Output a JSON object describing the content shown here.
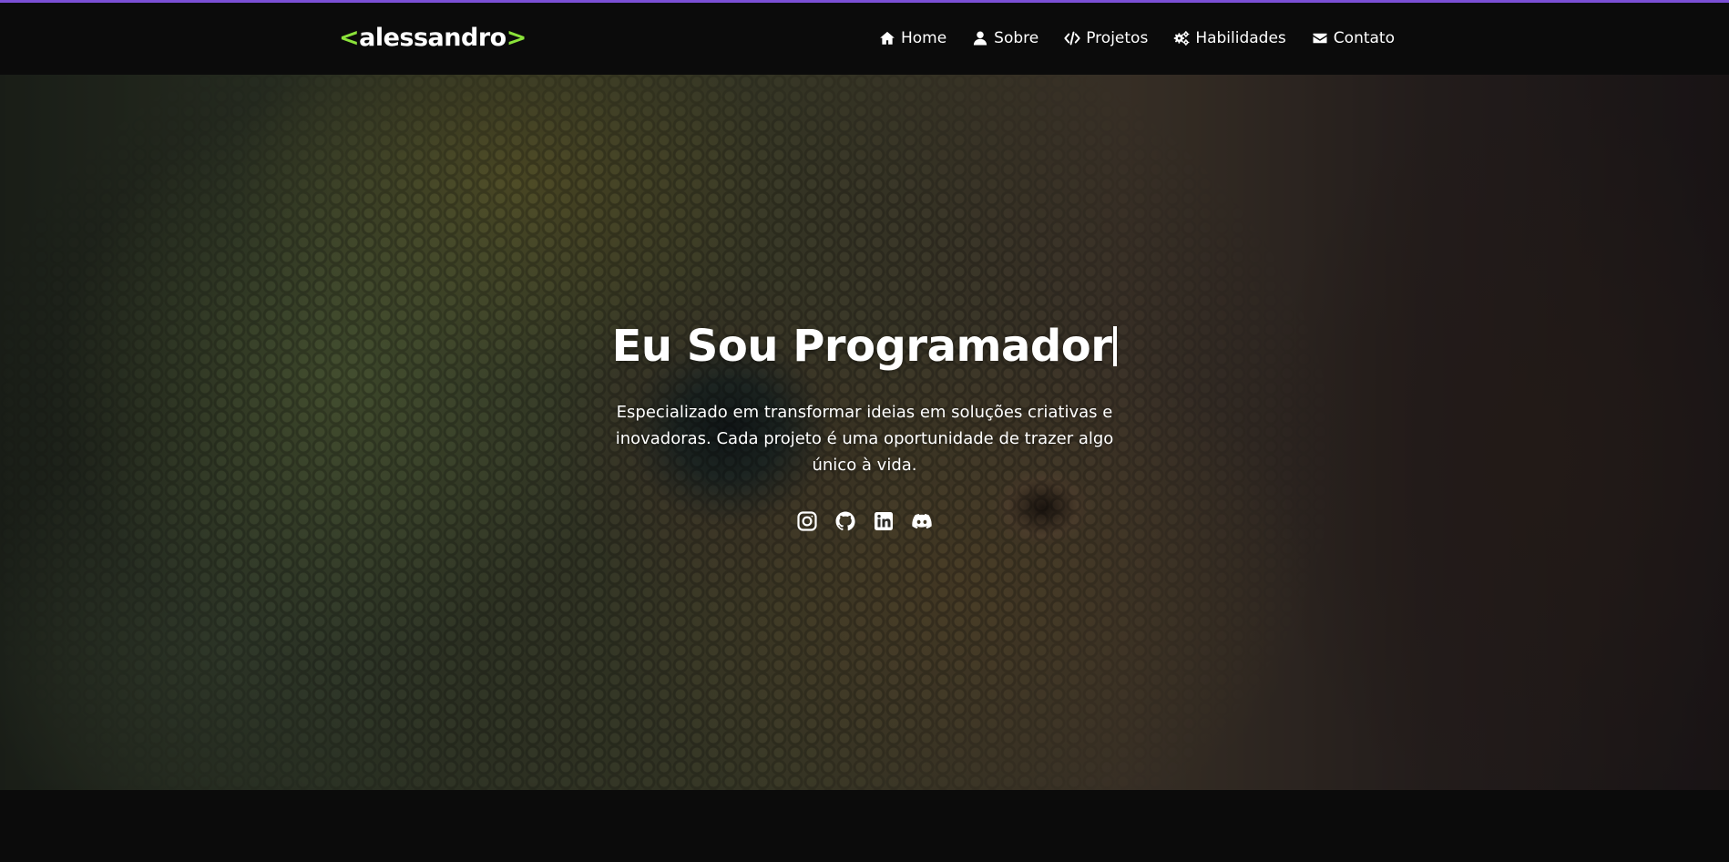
{
  "colors": {
    "accent": "#8be33a",
    "top_line": "#7b4fd6",
    "background": "#0b0b0b"
  },
  "logo": {
    "open": "<",
    "name": "alessandro",
    "close": ">"
  },
  "nav": [
    {
      "icon": "home-icon",
      "label": "Home"
    },
    {
      "icon": "user-icon",
      "label": "Sobre"
    },
    {
      "icon": "code-icon",
      "label": "Projetos"
    },
    {
      "icon": "gears-icon",
      "label": "Habilidades"
    },
    {
      "icon": "envelope-icon",
      "label": "Contato"
    }
  ],
  "hero": {
    "title": "Eu Sou Programador",
    "description": "Especializado em transformar ideias em soluções criativas e inovadoras. Cada projeto é uma oportunidade de trazer algo único à vida.",
    "background": "chameleon-eye-photo",
    "socials": [
      "instagram-icon",
      "github-icon",
      "linkedin-icon",
      "discord-icon"
    ]
  }
}
